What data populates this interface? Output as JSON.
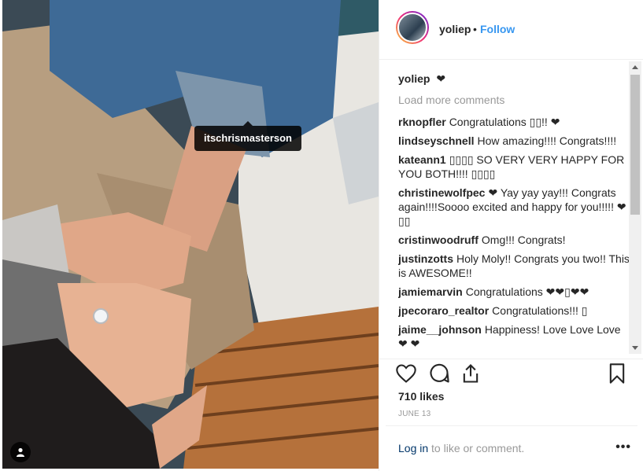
{
  "photo": {
    "tagged_user": "itschrismasterson"
  },
  "header": {
    "username": "yoliep",
    "separator": "•",
    "follow_label": "Follow"
  },
  "caption": {
    "username": "yoliep",
    "text": "❤"
  },
  "load_more_label": "Load more comments",
  "comments": [
    {
      "user": "rknopfler",
      "text": "Congratulations ▯▯!! ❤"
    },
    {
      "user": "lindseyschnell",
      "text": "How amazing!!!! Congrats!!!!"
    },
    {
      "user": "kateann1",
      "text": "▯▯▯▯ SO VERY VERY HAPPY FOR YOU BOTH!!!! ▯▯▯▯"
    },
    {
      "user": "christinewolfpec",
      "text": "❤ Yay yay yay!!! Congrats again!!!!Soooo excited and happy for you!!!!! ❤ ▯▯"
    },
    {
      "user": "cristinwoodruff",
      "text": "Omg!!! Congrats!"
    },
    {
      "user": "justinzotts",
      "text": "Holy Moly!! Congrats you two!! This is AWESOME!!"
    },
    {
      "user": "jamiemarvin",
      "text": "Congratulations ❤❤▯❤❤"
    },
    {
      "user": "jpecoraro_realtor",
      "text": "Congratulations!!! ▯"
    },
    {
      "user": "jaime__johnson",
      "text": "Happiness! Love Love Love ❤ ❤"
    }
  ],
  "likes_label": "710 likes",
  "date_label": "JUNE 13",
  "footer": {
    "login_link": "Log in",
    "login_rest": " to like or comment.",
    "more_label": "•••"
  },
  "icons": {
    "like": "heart-icon",
    "comment": "comment-icon",
    "share": "share-icon",
    "save": "bookmark-icon",
    "user_tags": "person-icon"
  }
}
